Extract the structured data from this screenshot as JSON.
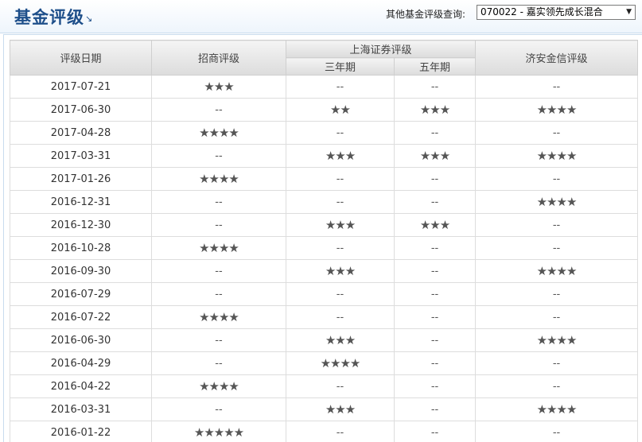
{
  "header": {
    "title": "基金评级",
    "title_arrow": "↘",
    "query_label": "其他基金评级查询:",
    "selected_fund": "070022 - 嘉实领先成长混合",
    "dropdown_arrow": "▼"
  },
  "table": {
    "headers": {
      "date": "评级日期",
      "zhaoshang": "招商评级",
      "shanghai": "上海证券评级",
      "three_year": "三年期",
      "five_year": "五年期",
      "jian": "济安金信评级"
    },
    "rows": [
      {
        "date": "2017-07-21",
        "zhaoshang": "★★★",
        "sh3": "--",
        "sh5": "--",
        "jian": "--"
      },
      {
        "date": "2017-06-30",
        "zhaoshang": "--",
        "sh3": "★★",
        "sh5": "★★★",
        "jian": "★★★★"
      },
      {
        "date": "2017-04-28",
        "zhaoshang": "★★★★",
        "sh3": "--",
        "sh5": "--",
        "jian": "--"
      },
      {
        "date": "2017-03-31",
        "zhaoshang": "--",
        "sh3": "★★★",
        "sh5": "★★★",
        "jian": "★★★★"
      },
      {
        "date": "2017-01-26",
        "zhaoshang": "★★★★",
        "sh3": "--",
        "sh5": "--",
        "jian": "--"
      },
      {
        "date": "2016-12-31",
        "zhaoshang": "--",
        "sh3": "--",
        "sh5": "--",
        "jian": "★★★★"
      },
      {
        "date": "2016-12-30",
        "zhaoshang": "--",
        "sh3": "★★★",
        "sh5": "★★★",
        "jian": "--"
      },
      {
        "date": "2016-10-28",
        "zhaoshang": "★★★★",
        "sh3": "--",
        "sh5": "--",
        "jian": "--"
      },
      {
        "date": "2016-09-30",
        "zhaoshang": "--",
        "sh3": "★★★",
        "sh5": "--",
        "jian": "★★★★"
      },
      {
        "date": "2016-07-29",
        "zhaoshang": "--",
        "sh3": "--",
        "sh5": "--",
        "jian": "--"
      },
      {
        "date": "2016-07-22",
        "zhaoshang": "★★★★",
        "sh3": "--",
        "sh5": "--",
        "jian": "--"
      },
      {
        "date": "2016-06-30",
        "zhaoshang": "--",
        "sh3": "★★★",
        "sh5": "--",
        "jian": "★★★★"
      },
      {
        "date": "2016-04-29",
        "zhaoshang": "--",
        "sh3": "★★★★",
        "sh5": "--",
        "jian": "--"
      },
      {
        "date": "2016-04-22",
        "zhaoshang": "★★★★",
        "sh3": "--",
        "sh5": "--",
        "jian": "--"
      },
      {
        "date": "2016-03-31",
        "zhaoshang": "--",
        "sh3": "★★★",
        "sh5": "--",
        "jian": "★★★★"
      },
      {
        "date": "2016-01-22",
        "zhaoshang": "★★★★★",
        "sh3": "--",
        "sh5": "--",
        "jian": "--"
      }
    ]
  }
}
